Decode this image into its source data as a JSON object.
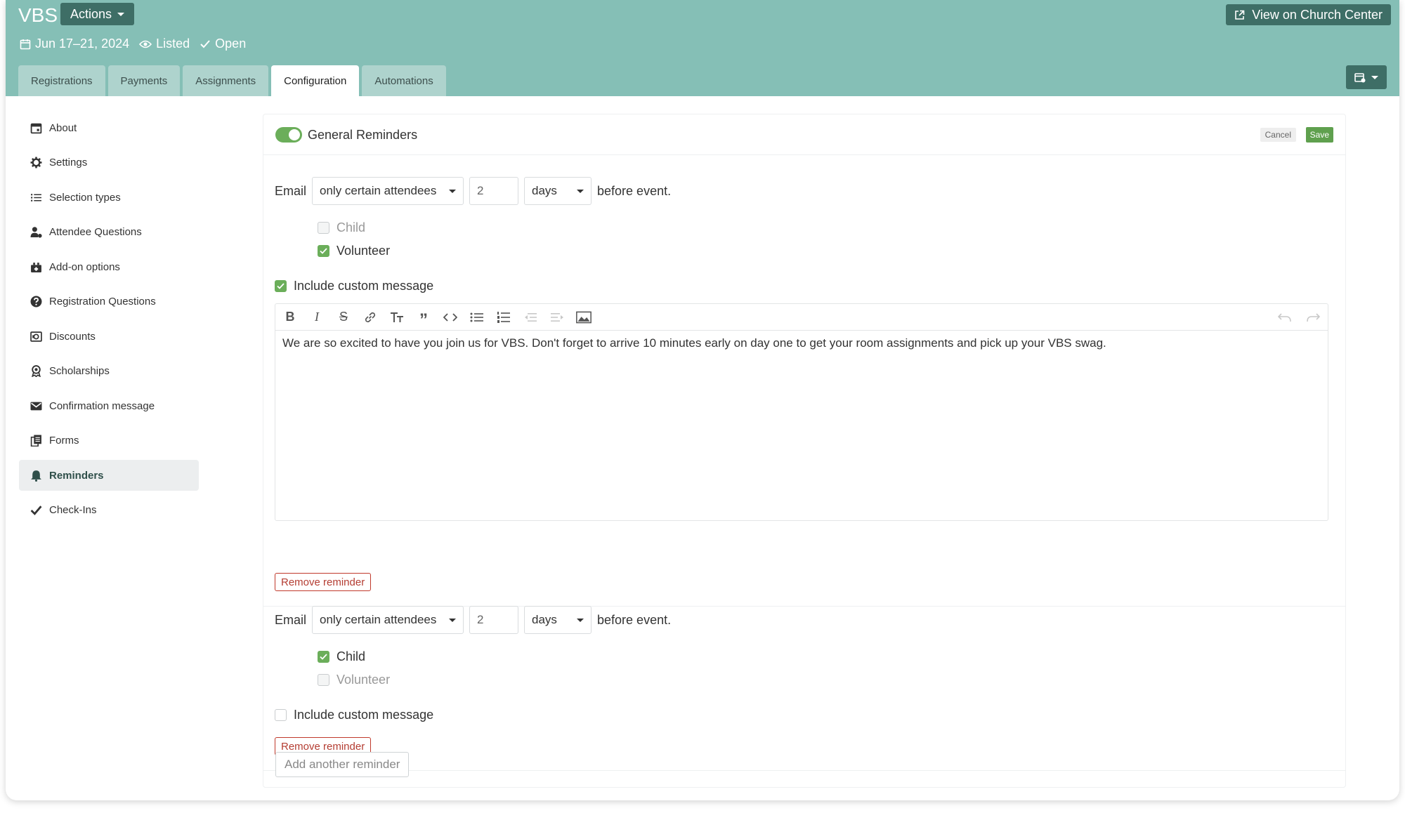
{
  "header": {
    "title": "VBS",
    "actions_label": "Actions",
    "date": "Jun 17–21, 2024",
    "listed": "Listed",
    "open": "Open",
    "view_label": "View on Church Center",
    "accent_color": "#85bfb6",
    "dark_button_color": "#3e6e66"
  },
  "tabs": [
    {
      "label": "Registrations"
    },
    {
      "label": "Payments"
    },
    {
      "label": "Assignments"
    },
    {
      "label": "Configuration",
      "active": true
    },
    {
      "label": "Automations"
    }
  ],
  "sidebar": {
    "items": [
      {
        "label": "About",
        "icon": "calendar-icon"
      },
      {
        "label": "Settings",
        "icon": "gear-icon"
      },
      {
        "label": "Selection types",
        "icon": "list-icon"
      },
      {
        "label": "Attendee Questions",
        "icon": "user-question-icon"
      },
      {
        "label": "Add-on options",
        "icon": "gift-box-icon"
      },
      {
        "label": "Registration Questions",
        "icon": "question-circle-icon"
      },
      {
        "label": "Discounts",
        "icon": "discount-icon"
      },
      {
        "label": "Scholarships",
        "icon": "award-icon"
      },
      {
        "label": "Confirmation message",
        "icon": "envelope-icon"
      },
      {
        "label": "Forms",
        "icon": "documents-icon"
      },
      {
        "label": "Reminders",
        "icon": "bell-icon",
        "active": true
      },
      {
        "label": "Check-Ins",
        "icon": "check-icon"
      }
    ]
  },
  "panel": {
    "title": "General Reminders",
    "enabled": true,
    "cancel_label": "Cancel",
    "save_label": "Save",
    "add_label": "Add another reminder"
  },
  "reminders": [
    {
      "channel": "Email",
      "audience": "only certain attendees",
      "amount": "2",
      "unit": "days",
      "suffix": "before event.",
      "options": [
        {
          "label": "Child",
          "checked": false
        },
        {
          "label": "Volunteer",
          "checked": true
        }
      ],
      "custom_label": "Include custom message",
      "custom_checked": true,
      "message": "We are so excited to have you join us for VBS. Don't forget to arrive 10 minutes early on day one to get your room assignments and pick up your VBS swag.",
      "remove_label": "Remove reminder"
    },
    {
      "channel": "Email",
      "audience": "only certain attendees",
      "amount": "2",
      "unit": "days",
      "suffix": "before event.",
      "options": [
        {
          "label": "Child",
          "checked": true
        },
        {
          "label": "Volunteer",
          "checked": false
        }
      ],
      "custom_label": "Include custom message",
      "custom_checked": false,
      "remove_label": "Remove reminder"
    }
  ]
}
